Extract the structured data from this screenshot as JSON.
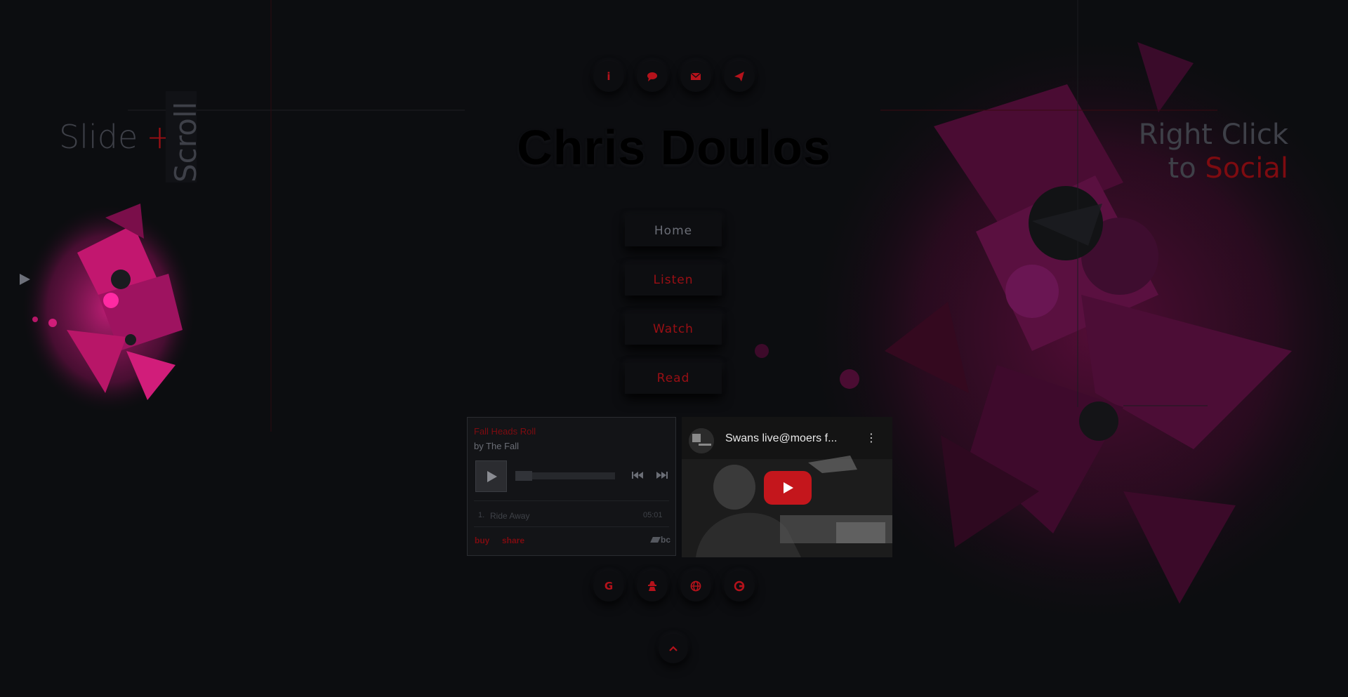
{
  "top_icons": [
    {
      "icon": "info-icon",
      "glyph": "i"
    },
    {
      "icon": "comment-icon",
      "glyph": ""
    },
    {
      "icon": "envelope-icon",
      "glyph": ""
    },
    {
      "icon": "paper-plane-icon",
      "glyph": ""
    }
  ],
  "title": "Chris Doulos",
  "left_label": {
    "slide": "Slide",
    "plus": "+",
    "scroll": "Scroll"
  },
  "right_label": {
    "line1": "Right Click",
    "to": "to",
    "social": "Social"
  },
  "nav": {
    "home": "Home",
    "listen": "Listen",
    "watch": "Watch",
    "read": "Read"
  },
  "bandcamp": {
    "album": "Fall Heads Roll",
    "artist": "by The Fall",
    "track_number": "1.",
    "track_name": "Ride Away",
    "track_time": "05:01",
    "buy": "buy",
    "share": "share",
    "logo": "bc"
  },
  "youtube": {
    "video_title": "Swans live@moers f...",
    "more": "⋮"
  },
  "bottom_icons": [
    {
      "icon": "google-icon",
      "glyph": "G"
    },
    {
      "icon": "user-secret-icon",
      "glyph": ""
    },
    {
      "icon": "globe-icon",
      "glyph": ""
    },
    {
      "icon": "refresh-icon",
      "glyph": ""
    }
  ],
  "scroll_top": {
    "icon": "chevron-up-icon"
  },
  "colors": {
    "accent": "#9b0f14",
    "background": "#0c0d10",
    "art_pink": "#c0186e"
  }
}
